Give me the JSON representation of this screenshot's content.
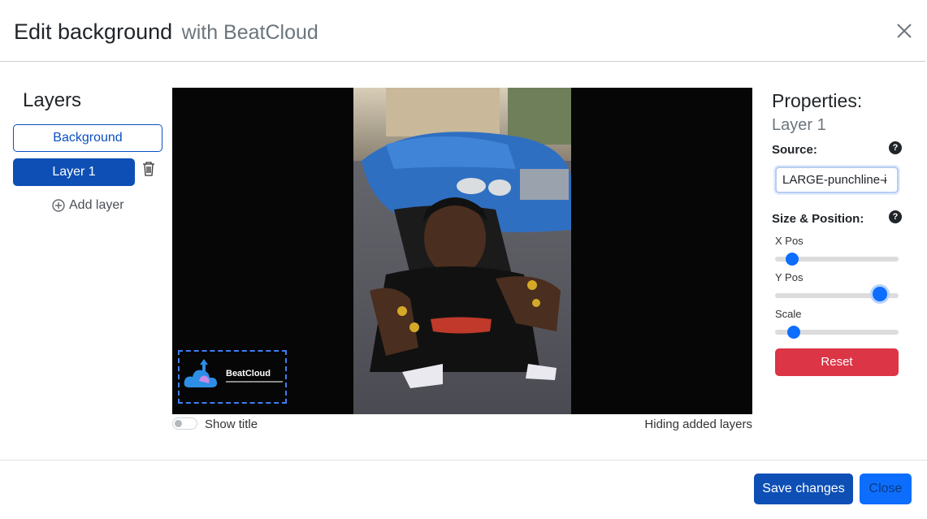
{
  "header": {
    "title": "Edit background",
    "subtitle": "with BeatCloud"
  },
  "layers": {
    "heading": "Layers",
    "items": [
      {
        "label": "Background",
        "selected": false
      },
      {
        "label": "Layer 1",
        "selected": true
      }
    ],
    "add_label": "Add layer"
  },
  "preview": {
    "logo_text": "BeatCloud",
    "show_title_label": "Show title",
    "show_title_on": false,
    "hiding_label": "Hiding added layers"
  },
  "properties": {
    "heading": "Properties:",
    "layer_name": "Layer 1",
    "source_label": "Source:",
    "source_value": "LARGE-punchline-i",
    "size_position_label": "Size & Position:",
    "x_pos_label": "X Pos",
    "y_pos_label": "Y Pos",
    "scale_label": "Scale",
    "x_pos_level": 0.14,
    "y_pos_level": 0.85,
    "scale_level": 0.15,
    "reset_label": "Reset"
  },
  "footer": {
    "save_label": "Save changes",
    "close_label": "Close"
  },
  "colors": {
    "primary": "#0d4fb5",
    "accent": "#0d6efd",
    "danger": "#dc3545"
  }
}
